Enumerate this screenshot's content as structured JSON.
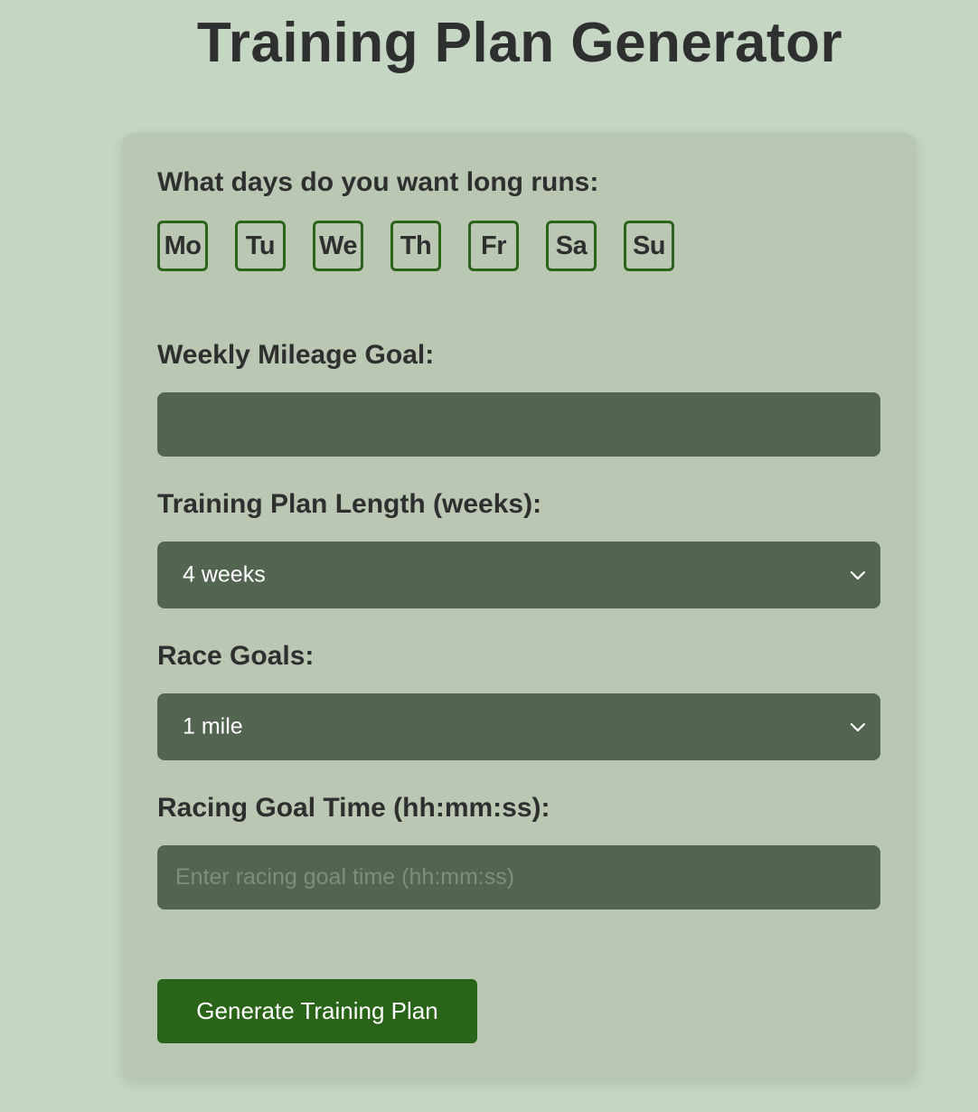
{
  "page": {
    "title": "Training Plan Generator"
  },
  "form": {
    "long_runs_label": "What days do you want long runs:",
    "days": [
      "Mo",
      "Tu",
      "We",
      "Th",
      "Fr",
      "Sa",
      "Su"
    ],
    "mileage_label": "Weekly Mileage Goal:",
    "mileage_value": "",
    "plan_length_label": "Training Plan Length (weeks):",
    "plan_length_selected": "4 weeks",
    "race_goals_label": "Race Goals:",
    "race_goals_selected": "1 mile",
    "goal_time_label": "Racing Goal Time (hh:mm:ss):",
    "goal_time_placeholder": "Enter racing goal time (hh:mm:ss)",
    "goal_time_value": "",
    "submit_label": "Generate Training Plan"
  },
  "colors": {
    "background": "#c5d6c3",
    "card": "#bac7b3",
    "field": "#536451",
    "accent": "#2a6418",
    "text": "#2e302f"
  },
  "icons": {
    "select_arrow": "chevron-down-icon"
  }
}
